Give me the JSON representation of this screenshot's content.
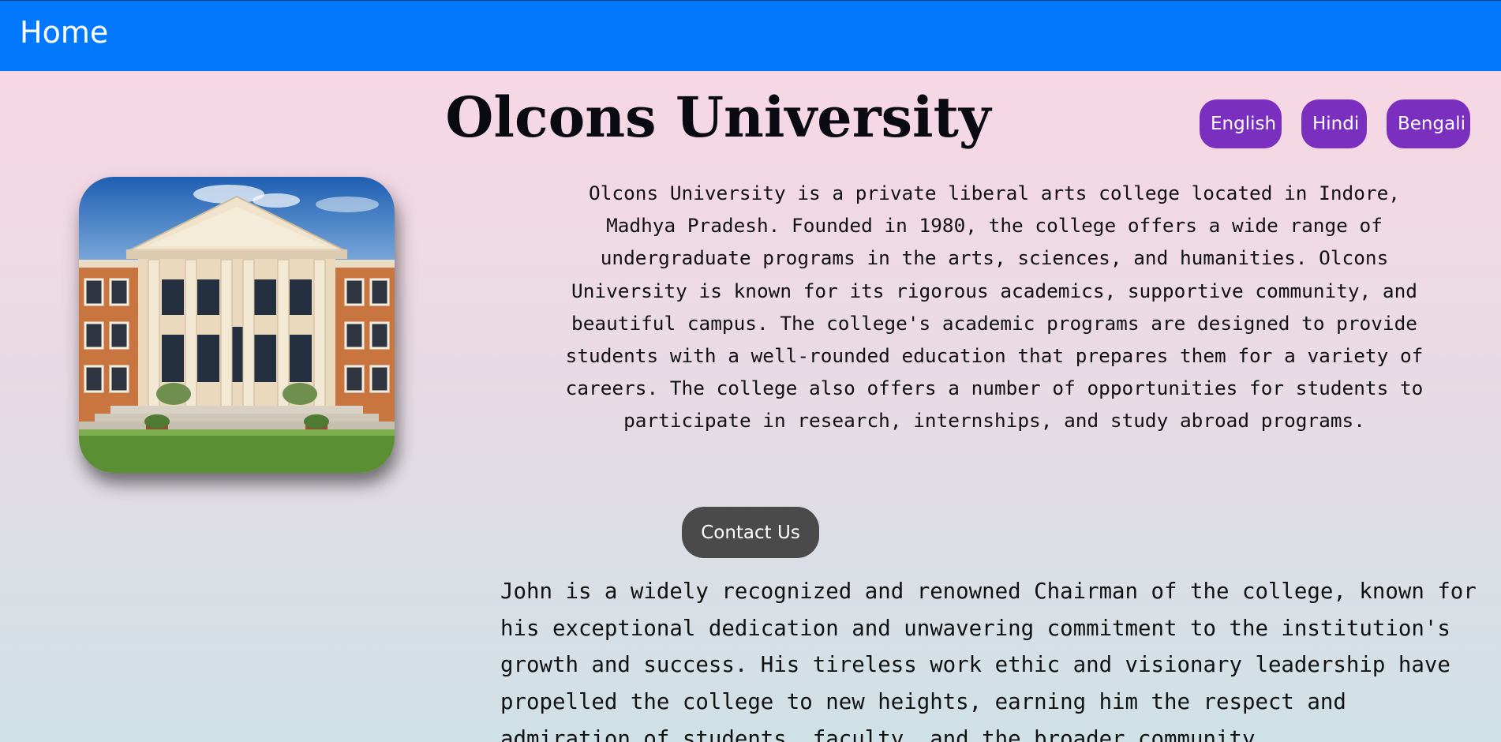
{
  "navbar": {
    "home_label": "Home",
    "color": "#0178fe"
  },
  "header": {
    "title": "Olcons University"
  },
  "languages": [
    {
      "label": "English"
    },
    {
      "label": "Hindi"
    },
    {
      "label": "Bengali"
    }
  ],
  "languages_color": "#7b2fbf",
  "intro": {
    "text": "Olcons University is a private liberal arts college located in Indore, Madhya Pradesh. Founded in 1980, the college offers a wide range of undergraduate programs in the arts, sciences, and humanities. Olcons University is known for its rigorous academics, supportive community, and beautiful campus. The college's academic programs are designed to provide students with a well-rounded education that prepares them for a variety of careers. The college also offers a number of opportunities for students to participate in research, internships, and study abroad programs."
  },
  "contact": {
    "label": "Contact Us"
  },
  "chairman": {
    "text": "John is a widely recognized and renowned Chairman of the college, known for his exceptional dedication and unwavering commitment to the institution's growth and success. His tireless work ethic and visionary leadership have propelled the college to new heights, earning him the respect and admiration of students, faculty, and the broader community."
  },
  "image": {
    "icon": "campus-building-photo"
  }
}
